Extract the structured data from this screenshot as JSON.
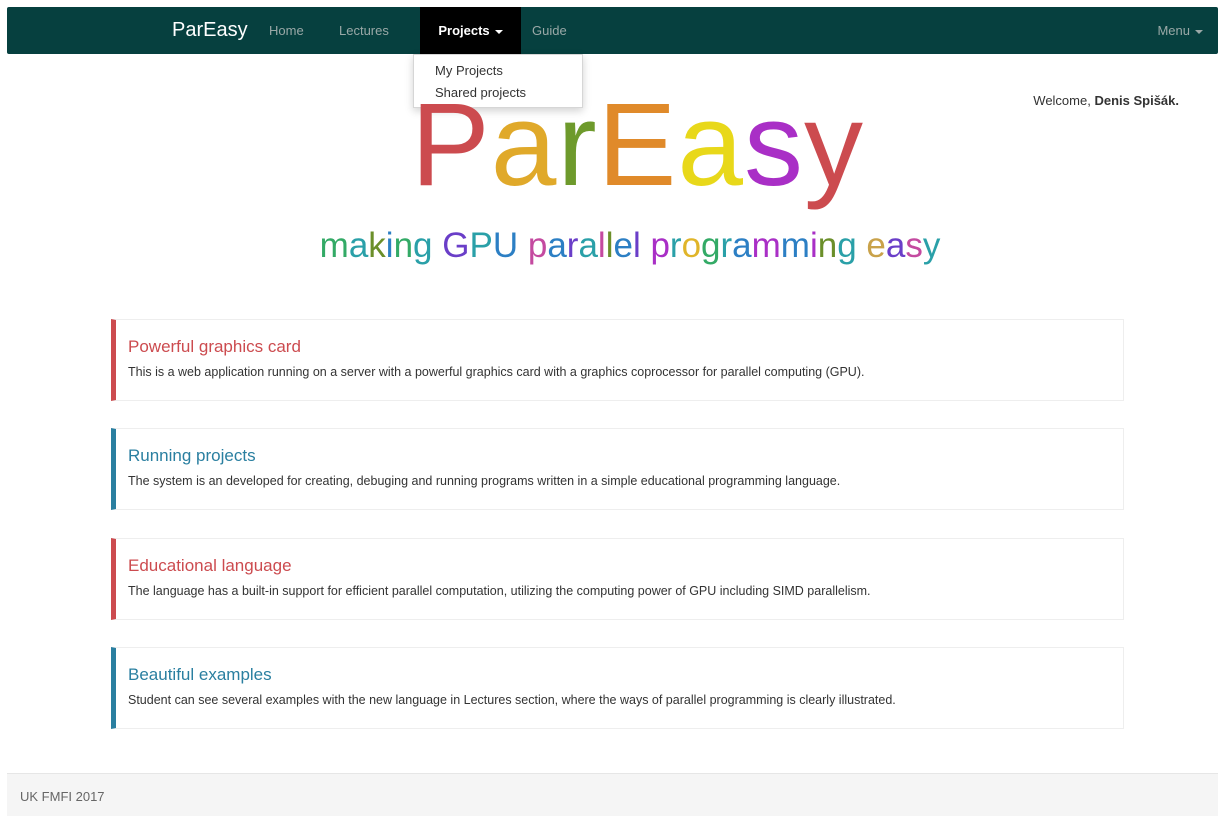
{
  "navbar": {
    "brand": "ParEasy",
    "background": "#06403f",
    "items": [
      {
        "label": "Home"
      },
      {
        "label": "Lectures"
      },
      {
        "label": "Projects"
      },
      {
        "label": "Guide"
      }
    ],
    "active": "Projects",
    "menu_label": "Menu"
  },
  "dropdown": {
    "items": [
      {
        "label": "My Projects"
      },
      {
        "label": "Shared projects"
      }
    ]
  },
  "welcome": {
    "prefix": "Welcome, ",
    "user": "Denis Spišák."
  },
  "hero": {
    "logo_letters": [
      {
        "char": "P",
        "color": "#cc4b4f"
      },
      {
        "char": "a",
        "color": "#e0a92a"
      },
      {
        "char": "r",
        "color": "#6e9a2c"
      },
      {
        "char": "E",
        "color": "#e08a2a"
      },
      {
        "char": "a",
        "color": "#e8d81a"
      },
      {
        "char": "s",
        "color": "#a92fc6"
      },
      {
        "char": "y",
        "color": "#cc4b4f"
      }
    ],
    "tagline_letters": [
      {
        "char": "m",
        "color": "#33aa66"
      },
      {
        "char": "a",
        "color": "#2aa0a8"
      },
      {
        "char": "k",
        "color": "#6b8f2a"
      },
      {
        "char": "i",
        "color": "#2c7fc4"
      },
      {
        "char": "n",
        "color": "#33aa66"
      },
      {
        "char": "g",
        "color": "#2aa0a8"
      },
      {
        "char": " ",
        "color": "#333333"
      },
      {
        "char": "G",
        "color": "#6a3ec8"
      },
      {
        "char": "P",
        "color": "#2aa0a8"
      },
      {
        "char": "U",
        "color": "#2c7fc4"
      },
      {
        "char": " ",
        "color": "#333333"
      },
      {
        "char": "p",
        "color": "#c44aa0"
      },
      {
        "char": "a",
        "color": "#2c7fc4"
      },
      {
        "char": "r",
        "color": "#6a3ec8"
      },
      {
        "char": "a",
        "color": "#2aa0a8"
      },
      {
        "char": "l",
        "color": "#c44aa0"
      },
      {
        "char": "l",
        "color": "#6b8f2a"
      },
      {
        "char": "e",
        "color": "#2c7fc4"
      },
      {
        "char": "l",
        "color": "#6a3ec8"
      },
      {
        "char": " ",
        "color": "#333333"
      },
      {
        "char": "p",
        "color": "#a92fc6"
      },
      {
        "char": "r",
        "color": "#2aa0a8"
      },
      {
        "char": "o",
        "color": "#e0b52a"
      },
      {
        "char": "g",
        "color": "#33aa66"
      },
      {
        "char": "r",
        "color": "#2aa0a8"
      },
      {
        "char": "a",
        "color": "#2c7fc4"
      },
      {
        "char": "m",
        "color": "#a92fc6"
      },
      {
        "char": "m",
        "color": "#2c7fc4"
      },
      {
        "char": "i",
        "color": "#a92fc6"
      },
      {
        "char": "n",
        "color": "#6b8f2a"
      },
      {
        "char": "g",
        "color": "#2aa0a8"
      },
      {
        "char": " ",
        "color": "#333333"
      },
      {
        "char": "e",
        "color": "#c9a24a"
      },
      {
        "char": "a",
        "color": "#6a3ec8"
      },
      {
        "char": "s",
        "color": "#c44aa0"
      },
      {
        "char": "y",
        "color": "#2aa0a8"
      }
    ]
  },
  "features": [
    {
      "title": "Powerful graphics card",
      "text": "This is a web application running on a server with a powerful graphics card with a graphics coprocessor for parallel computing (GPU).",
      "accent": "#cc4b4f"
    },
    {
      "title": "Running projects",
      "text": "The system is an developed for creating, debuging and running programs written in a simple educational programming language.",
      "accent": "#2a7fa0"
    },
    {
      "title": "Educational language",
      "text": "The language has a built-in support for efficient parallel computation, utilizing the computing power of GPU including SIMD parallelism.",
      "accent": "#cc4b4f"
    },
    {
      "title": "Beautiful examples",
      "text": "Student can see several examples with the new language in Lectures section, where the ways of parallel programming is clearly illustrated.",
      "accent": "#2a7fa0"
    }
  ],
  "footer": {
    "text": "UK FMFI 2017"
  }
}
